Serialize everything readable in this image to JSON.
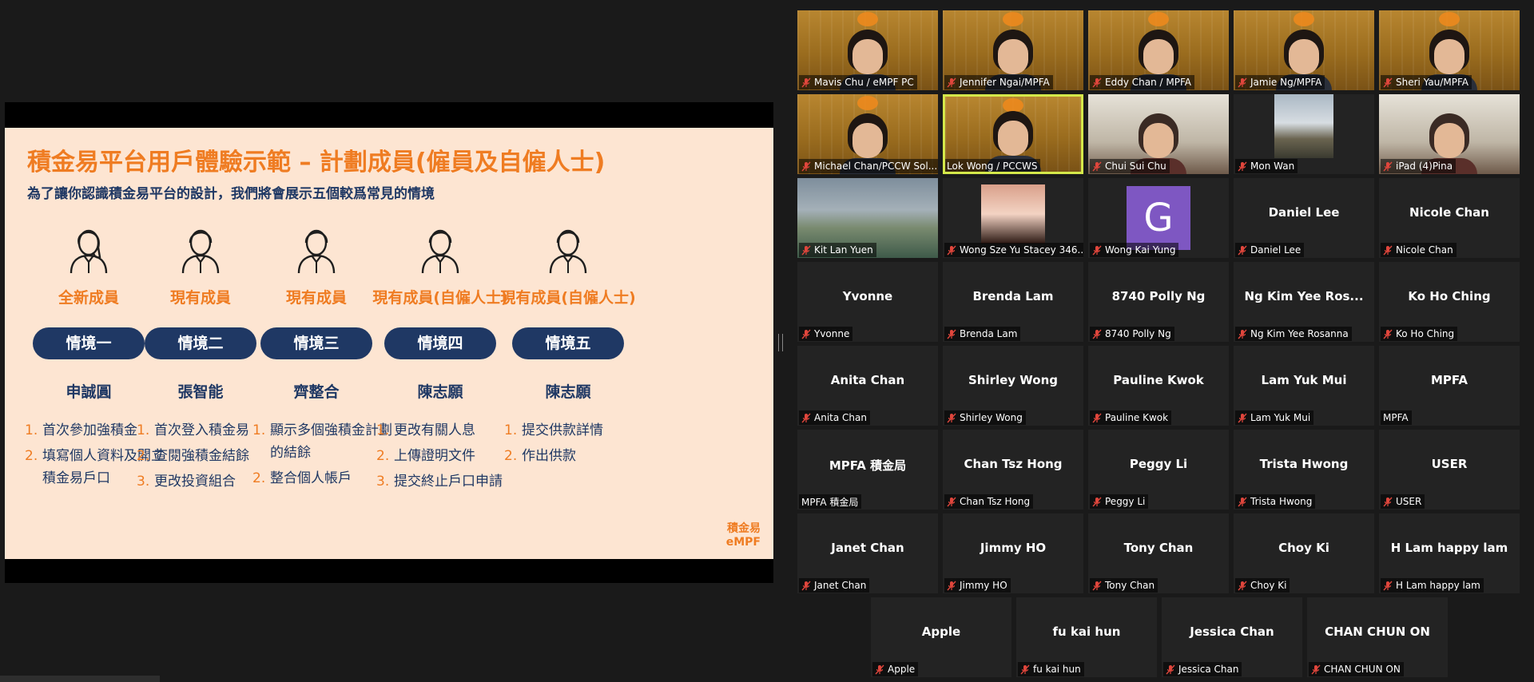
{
  "slide": {
    "title": "積金易平台用戶體驗示範 – 計劃成員(僱員及自僱人士)",
    "subtitle": "為了讓你認識積金易平台的設計，我們將會展示五個較爲常見的情境",
    "logo_line1": "積金易",
    "logo_line2": "eMPF",
    "accent_color": "#ef7c22",
    "navy_color": "#1f3864",
    "scenarios": [
      {
        "role": "全新成員",
        "pill": "情境一",
        "name": "申誠圓",
        "gender": "female",
        "steps": [
          {
            "n": "1.",
            "text": "首次參加強積金"
          },
          {
            "n": "2.",
            "text": "填寫個人資料及開立積金易戶口"
          }
        ]
      },
      {
        "role": "現有成員",
        "pill": "情境二",
        "name": "張智能",
        "gender": "male",
        "steps": [
          {
            "n": "1.",
            "text": "首次登入積金易"
          },
          {
            "n": "2.",
            "text": "查閱強積金結餘"
          },
          {
            "n": "3.",
            "text": "更改投資組合"
          }
        ]
      },
      {
        "role": "現有成員",
        "pill": "情境三",
        "name": "齊整合",
        "gender": "male",
        "steps": [
          {
            "n": "1.",
            "text": "顯示多個強積金計劃的結餘"
          },
          {
            "n": "2.",
            "text": "整合個人帳戶"
          }
        ]
      },
      {
        "role": "現有成員(自僱人士)",
        "pill": "情境四",
        "name": "陳志願",
        "gender": "male",
        "steps": [
          {
            "n": "1.",
            "text": "更改有關人息"
          },
          {
            "n": "2.",
            "text": "上傳證明文件"
          },
          {
            "n": "3.",
            "text": "提交終止戶口申請"
          }
        ]
      },
      {
        "role": "現有成員(自僱人士)",
        "pill": "情境五",
        "name": "陳志願",
        "gender": "male",
        "steps": [
          {
            "n": "1.",
            "text": "提交供款詳情"
          },
          {
            "n": "2.",
            "text": "作出供款"
          }
        ]
      }
    ]
  },
  "gallery": {
    "active_border_color": "#d4e84a",
    "participants": [
      {
        "label": "Mavis Chu / eMPF PC",
        "kind": "mpfa",
        "muted": true
      },
      {
        "label": "Jennifer Ngai/MPFA",
        "kind": "mpfa",
        "muted": true
      },
      {
        "label": "Eddy Chan / MPFA",
        "kind": "mpfa",
        "muted": true
      },
      {
        "label": "Jamie Ng/MPFA",
        "kind": "mpfa",
        "muted": true
      },
      {
        "label": "Sheri Yau/MPFA",
        "kind": "mpfa",
        "muted": true
      },
      {
        "label": "Michael Chan/PCCW Sol...",
        "kind": "mpfa",
        "muted": true
      },
      {
        "label": "Lok Wong / PCCWS",
        "kind": "mpfa-active",
        "muted": false
      },
      {
        "label": "Chui Sui Chu",
        "kind": "home",
        "muted": true
      },
      {
        "label": "Mon Wan",
        "kind": "snow",
        "muted": true
      },
      {
        "label": "iPad (4)Pina",
        "kind": "home",
        "muted": true
      },
      {
        "label": "Kit Lan Yuen",
        "kind": "landscape",
        "muted": true
      },
      {
        "label": "Wong Sze Yu Stacey 346...",
        "kind": "portrait",
        "muted": true
      },
      {
        "label": "Wong Kai Yung",
        "kind": "avatar",
        "avatar": "G",
        "muted": true
      },
      {
        "label": "Daniel Lee",
        "center": "Daniel Lee",
        "kind": "name",
        "muted": true
      },
      {
        "label": "Nicole Chan",
        "center": "Nicole Chan",
        "kind": "name",
        "muted": true
      },
      {
        "label": "Yvonne",
        "center": "Yvonne",
        "kind": "name",
        "muted": true
      },
      {
        "label": "Brenda Lam",
        "center": "Brenda Lam",
        "kind": "name",
        "muted": true
      },
      {
        "label": "8740 Polly Ng",
        "center": "8740 Polly Ng",
        "kind": "name",
        "muted": true
      },
      {
        "label": "Ng Kim Yee Rosanna",
        "center": "Ng Kim Yee Ros...",
        "kind": "name",
        "muted": true
      },
      {
        "label": "Ko Ho Ching",
        "center": "Ko Ho Ching",
        "kind": "name",
        "muted": true
      },
      {
        "label": "Anita Chan",
        "center": "Anita Chan",
        "kind": "name",
        "muted": true
      },
      {
        "label": "Shirley Wong",
        "center": "Shirley Wong",
        "kind": "name",
        "muted": true
      },
      {
        "label": "Pauline Kwok",
        "center": "Pauline Kwok",
        "kind": "name",
        "muted": true
      },
      {
        "label": "Lam Yuk Mui",
        "center": "Lam Yuk Mui",
        "kind": "name",
        "muted": true
      },
      {
        "label": "MPFA",
        "center": "MPFA",
        "kind": "name",
        "muted": false
      },
      {
        "label": "MPFA 積金局",
        "center": "MPFA 積金局",
        "kind": "name",
        "muted": false
      },
      {
        "label": "Chan Tsz Hong",
        "center": "Chan Tsz Hong",
        "kind": "name",
        "muted": true
      },
      {
        "label": "Peggy Li",
        "center": "Peggy Li",
        "kind": "name",
        "muted": true
      },
      {
        "label": "Trista Hwong",
        "center": "Trista Hwong",
        "kind": "name",
        "muted": true
      },
      {
        "label": "USER",
        "center": "USER",
        "kind": "name",
        "muted": true
      },
      {
        "label": "Janet Chan",
        "center": "Janet Chan",
        "kind": "name",
        "muted": true
      },
      {
        "label": "Jimmy HO",
        "center": "Jimmy HO",
        "kind": "name",
        "muted": true
      },
      {
        "label": "Tony Chan",
        "center": "Tony Chan",
        "kind": "name",
        "muted": true
      },
      {
        "label": "Choy Ki",
        "center": "Choy Ki",
        "kind": "name",
        "muted": true
      },
      {
        "label": "H Lam happy lam",
        "center": "H Lam happy lam",
        "kind": "name",
        "muted": true
      },
      {
        "label": "Apple",
        "center": "Apple",
        "kind": "name",
        "muted": true
      },
      {
        "label": "fu kai hun",
        "center": "fu kai hun",
        "kind": "name",
        "muted": true
      },
      {
        "label": "Jessica Chan",
        "center": "Jessica Chan",
        "kind": "name",
        "muted": true
      },
      {
        "label": "CHAN CHUN ON",
        "center": "CHAN CHUN ON",
        "kind": "name",
        "muted": true
      }
    ]
  }
}
